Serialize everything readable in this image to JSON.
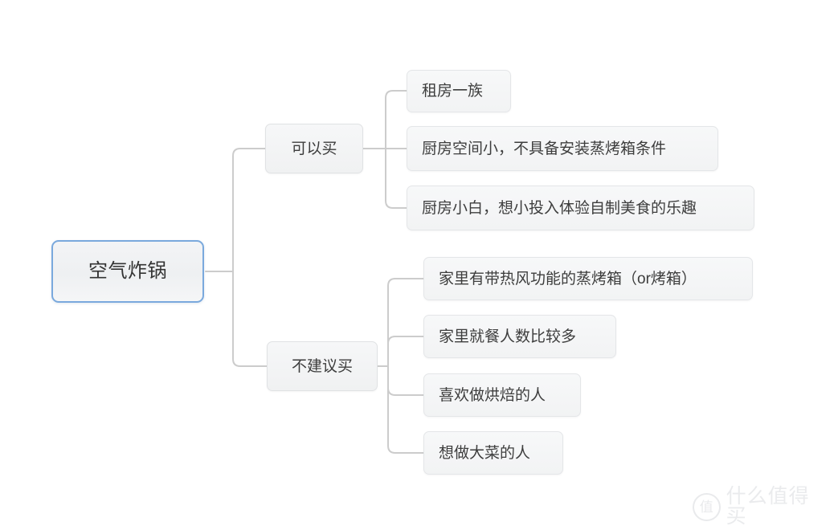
{
  "diagram": {
    "type": "mindmap",
    "orientation": "left-to-right",
    "background_color": "#ffffff",
    "connector_color": "#cccccc",
    "root": {
      "id": "root",
      "label": "空气炸锅",
      "border_color": "#7aa9dd",
      "fill_color": "#f1f3f5",
      "text_color": "#333333"
    },
    "branches": [
      {
        "id": "branch-can-buy",
        "label": "可以买",
        "fill_color": "#f4f5f6",
        "border_color": "#e0e2e4",
        "children": [
          {
            "id": "leaf-renters",
            "label": "租房一族"
          },
          {
            "id": "leaf-small-kitchen",
            "label": "厨房空间小，不具备安装蒸烤箱条件"
          },
          {
            "id": "leaf-kitchen-novice",
            "label": "厨房小白，想小投入体验自制美食的乐趣"
          }
        ]
      },
      {
        "id": "branch-not-recommended",
        "label": "不建议买",
        "fill_color": "#f4f5f6",
        "border_color": "#e0e2e4",
        "children": [
          {
            "id": "leaf-has-steam-oven",
            "label": "家里有带热风功能的蒸烤箱（or烤箱）"
          },
          {
            "id": "leaf-many-diners",
            "label": "家里就餐人数比较多"
          },
          {
            "id": "leaf-likes-baking",
            "label": "喜欢做烘焙的人"
          },
          {
            "id": "leaf-big-dishes",
            "label": "想做大菜的人"
          }
        ]
      }
    ]
  },
  "watermark": {
    "logo_glyph": "值",
    "text": "什么值得买",
    "color": "#eaebed"
  }
}
